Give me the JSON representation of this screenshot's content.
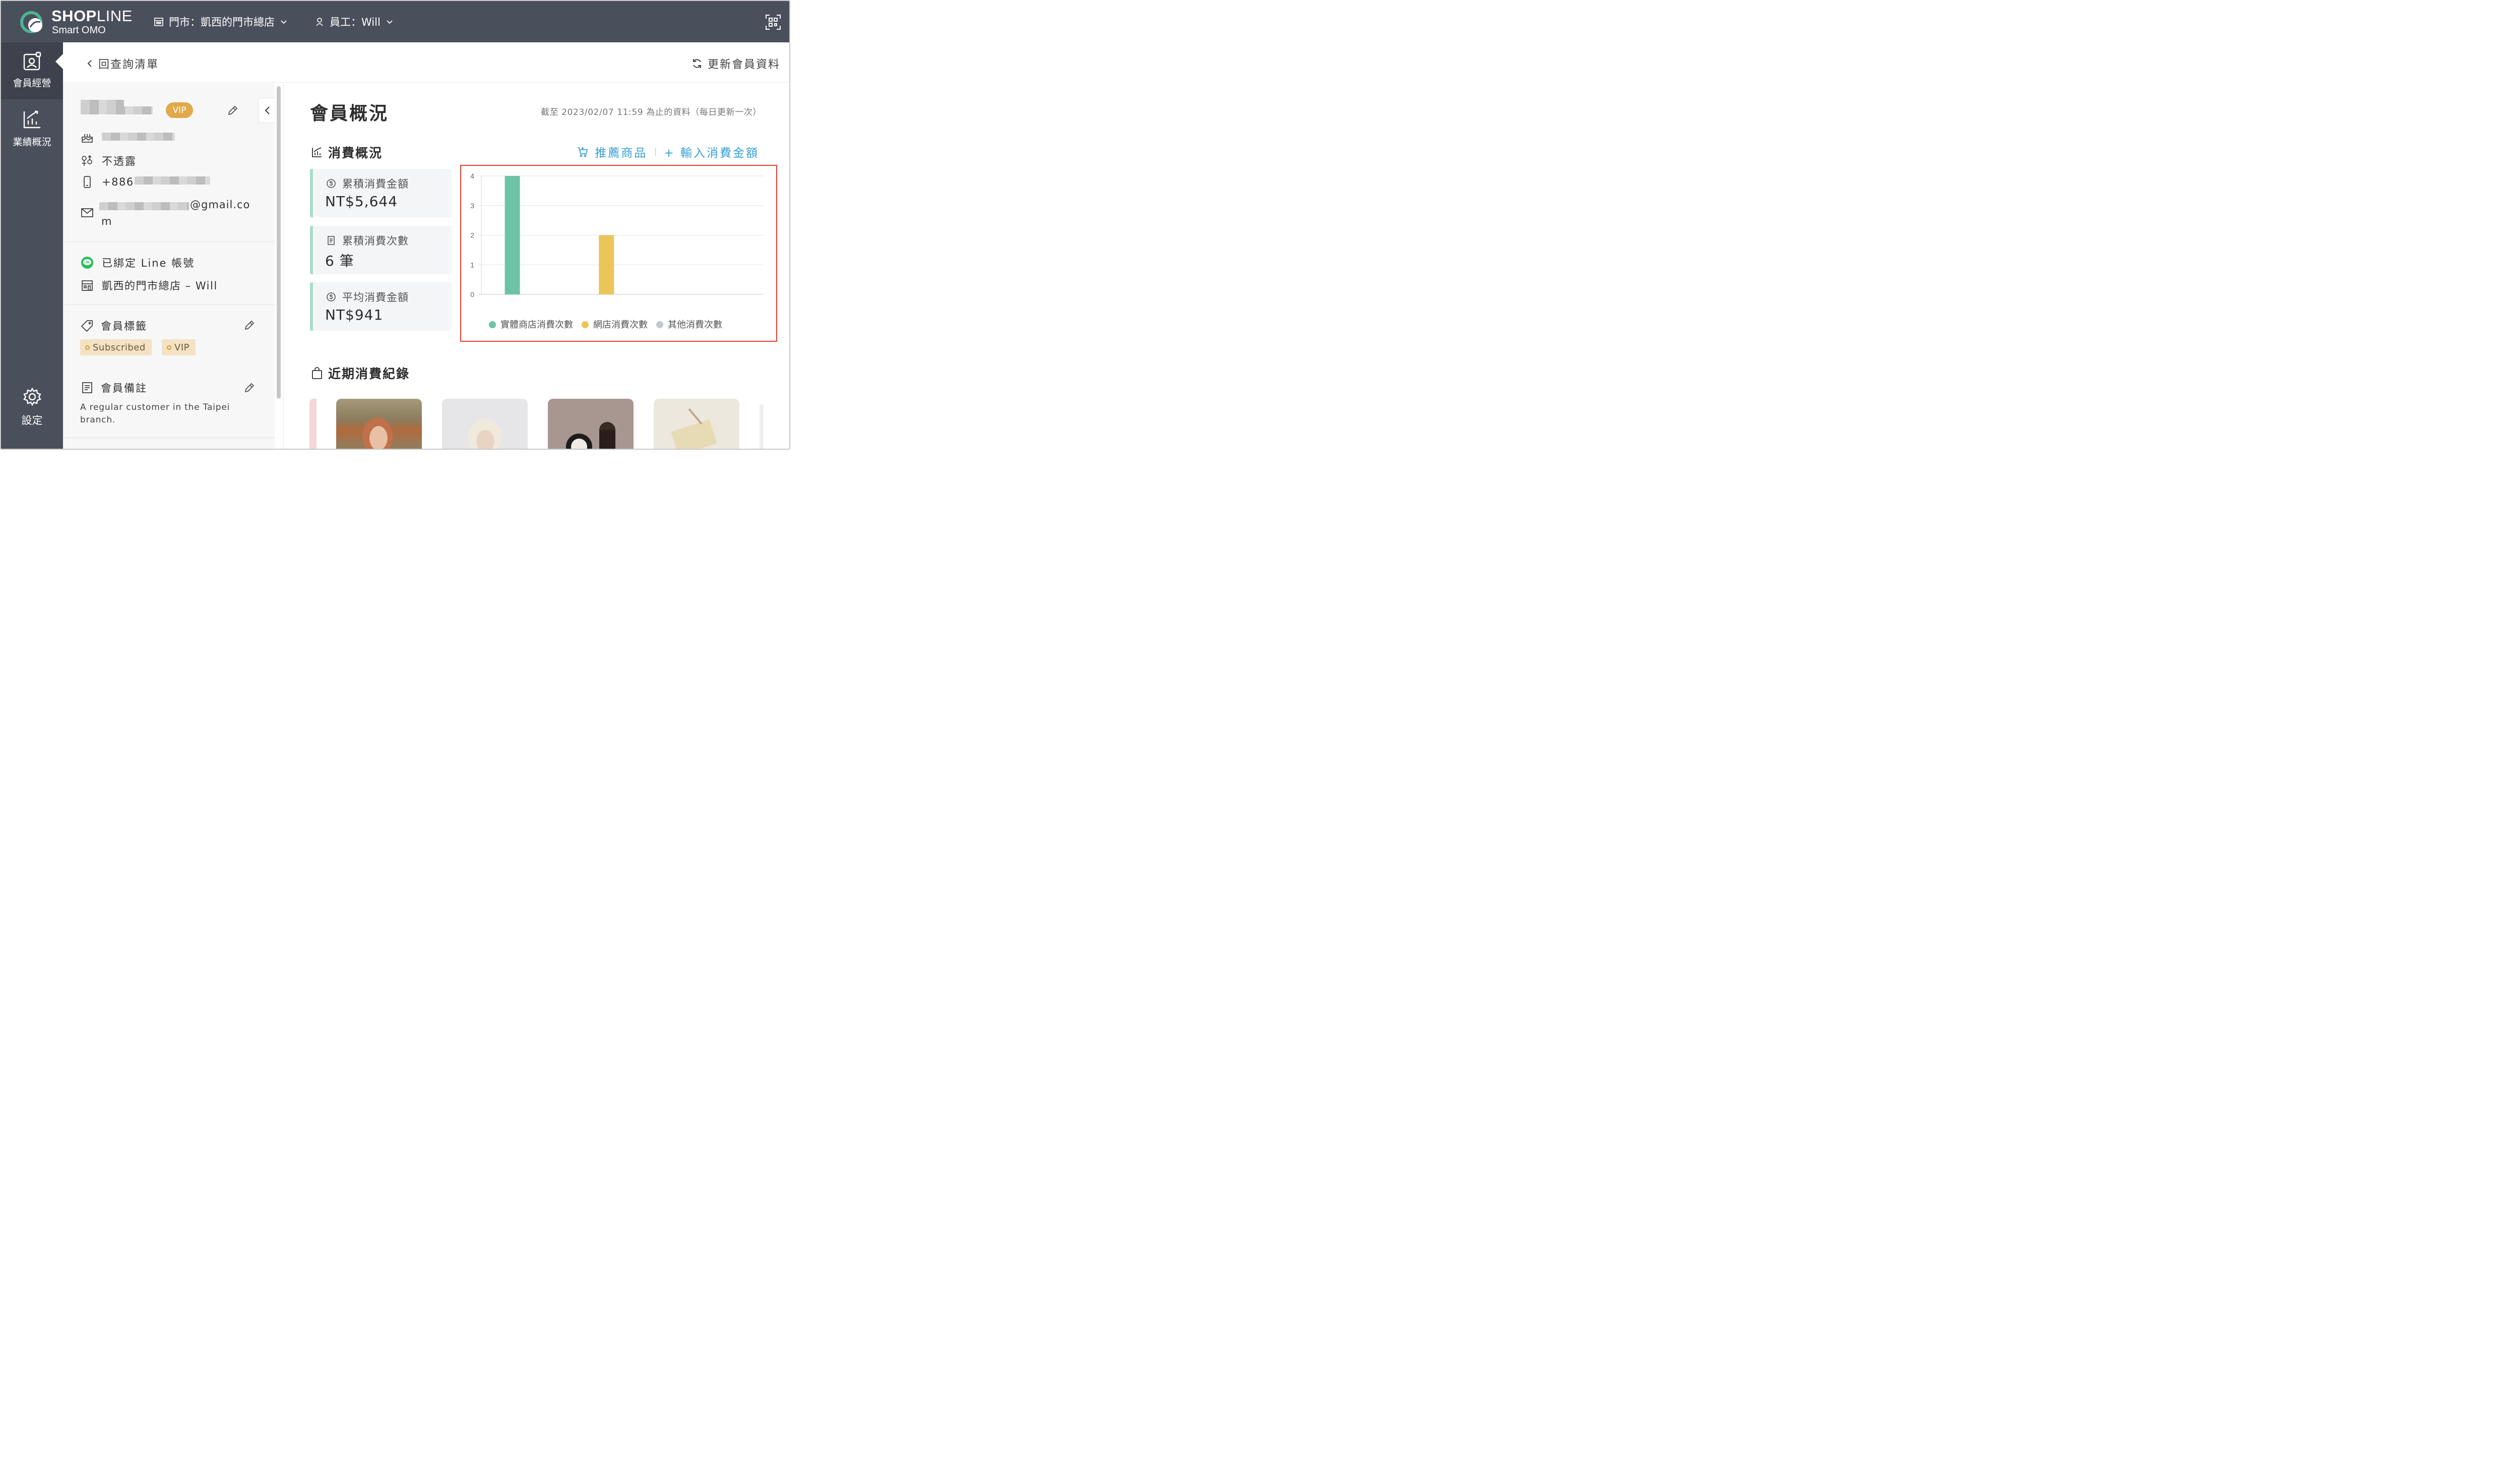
{
  "topbar": {
    "brand": "SHOPLINE",
    "brand_sub": "Smart OMO",
    "store_selector": "門市：凱西的門市總店",
    "staff_selector": "員工：Will"
  },
  "sidebar": {
    "items": [
      {
        "label": "會員經營",
        "icon": "member-card-icon",
        "active": true
      },
      {
        "label": "業績概況",
        "icon": "performance-chart-icon",
        "active": false
      },
      {
        "label": "設定",
        "icon": "gear-icon",
        "active": false
      }
    ]
  },
  "subheader": {
    "back_label": "回查詢清單",
    "refresh_label": "更新會員資料"
  },
  "profile": {
    "vip_badge": "VIP",
    "gender": "不透露",
    "phone_prefix": "+886",
    "email_suffix": "@gmail.co",
    "email_suffix_wrap": "m",
    "line_status": "已綁定 Line 帳號",
    "store_staff": "凱西的門市總店 – Will",
    "tags_title": "會員標籤",
    "tags": [
      "Subscribed",
      "VIP"
    ],
    "notes_title": "會員備註",
    "notes_text": "A regular customer in the Taipei branch."
  },
  "main": {
    "title": "會員概況",
    "as_of": "截至 2023/02/07 11:59 為止的資料（每日更新一次）",
    "spending_title": "消費概況",
    "recommend_label": "推薦商品",
    "input_amount_label": "+ 輸入消費金額",
    "stats": [
      {
        "label": "累積消費金額",
        "value": "NT$5,644",
        "icon": "dollar-icon"
      },
      {
        "label": "累積消費次數",
        "value": "6 筆",
        "icon": "receipt-icon"
      },
      {
        "label": "平均消費金額",
        "value": "NT$941",
        "icon": "dollar-icon"
      }
    ],
    "recent_title": "近期消費紀錄"
  },
  "colors": {
    "topbar": "#4a4f5c",
    "accent_blue": "#3a9fd6",
    "vip": "#e0a94a",
    "highlight_border": "#e2402c",
    "series_store": "#6cc4a4",
    "series_online": "#ebc55a",
    "series_other": "#c5c8d0"
  },
  "chart_data": {
    "type": "bar",
    "categories": [
      "實體商店消費次數",
      "網店消費次數",
      "其他消費次數"
    ],
    "series": [
      {
        "name": "實體商店消費次數",
        "values": [
          4
        ],
        "color": "#6cc4a4"
      },
      {
        "name": "網店消費次數",
        "values": [
          2
        ],
        "color": "#ebc55a"
      },
      {
        "name": "其他消費次數",
        "values": [
          0
        ],
        "color": "#c5c8d0"
      }
    ],
    "yticks": [
      "0",
      "1",
      "2",
      "3",
      "4"
    ],
    "ylim": [
      0,
      4
    ],
    "grid": true,
    "legend": "bottom",
    "title": "",
    "xlabel": "",
    "ylabel": ""
  }
}
